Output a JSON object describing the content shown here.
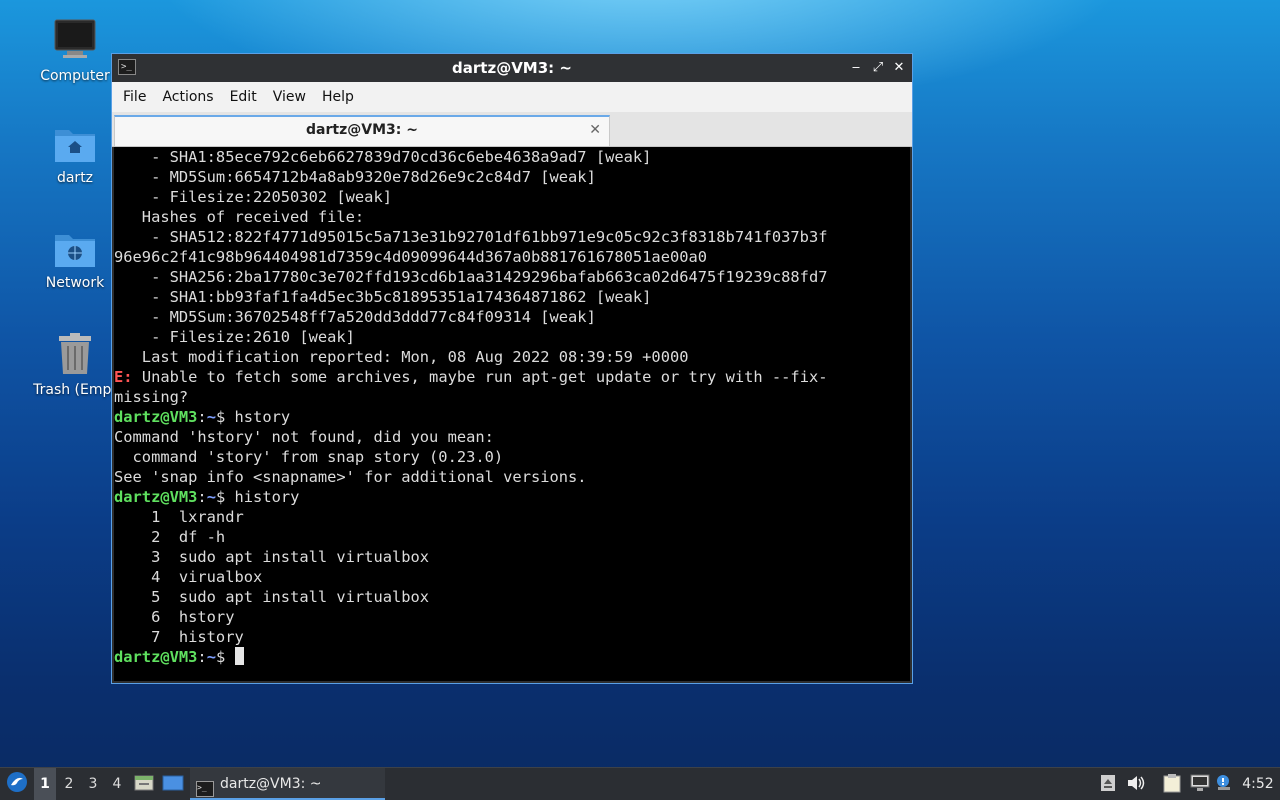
{
  "desktop": {
    "icons": [
      {
        "label": "Computer"
      },
      {
        "label": "dartz"
      },
      {
        "label": "Network"
      },
      {
        "label": "Trash (Empt"
      }
    ]
  },
  "window": {
    "title": "dartz@VM3: ~",
    "controls": {
      "minimize": "‒",
      "maximize": "⤢",
      "close": "✕"
    },
    "menu": [
      "File",
      "Actions",
      "Edit",
      "View",
      "Help"
    ],
    "tab": {
      "label": "dartz@VM3: ~",
      "close": "✕"
    }
  },
  "terminal": {
    "prompt_user": "dartz@VM3",
    "prompt_path": "~",
    "prompt_symbol": "$",
    "lines": [
      "    - SHA1:85ece792c6eb6627839d70cd36c6ebe4638a9ad7 [weak]",
      "    - MD5Sum:6654712b4a8ab9320e78d26e9c2c84d7 [weak]",
      "    - Filesize:22050302 [weak]",
      "   Hashes of received file:",
      "    - SHA512:822f4771d95015c5a713e31b92701df61bb971e9c05c92c3f8318b741f037b3f",
      "96e96c2f41c98b964404981d7359c4d09099644d367a0b881761678051ae00a0",
      "    - SHA256:2ba17780c3e702ffd193cd6b1aa31429296bafab663ca02d6475f19239c88fd7",
      "    - SHA1:bb93faf1fa4d5ec3b5c81895351a174364871862 [weak]",
      "    - MD5Sum:36702548ff7a520dd3ddd77c84f09314 [weak]",
      "    - Filesize:2610 [weak]",
      "   Last modification reported: Mon, 08 Aug 2022 08:39:59 +0000"
    ],
    "error_prefix": "E:",
    "error_text": " Unable to fetch some archives, maybe run apt-get update or try with --fix-",
    "error_cont": "missing?",
    "cmd1": " hstory",
    "cmd1_output": [
      "Command 'hstory' not found, did you mean:",
      "  command 'story' from snap story (0.23.0)",
      "See 'snap info <snapname>' for additional versions."
    ],
    "cmd2": " history",
    "history": [
      "    1  lxrandr",
      "    2  df -h",
      "    3  sudo apt install virtualbox",
      "    4  virualbox",
      "    5  sudo apt install virtualbox",
      "    6  hstory",
      "    7  history"
    ]
  },
  "taskbar": {
    "workspaces": [
      "1",
      "2",
      "3",
      "4"
    ],
    "task_label": "dartz@VM3: ~",
    "clock": "4:52"
  }
}
